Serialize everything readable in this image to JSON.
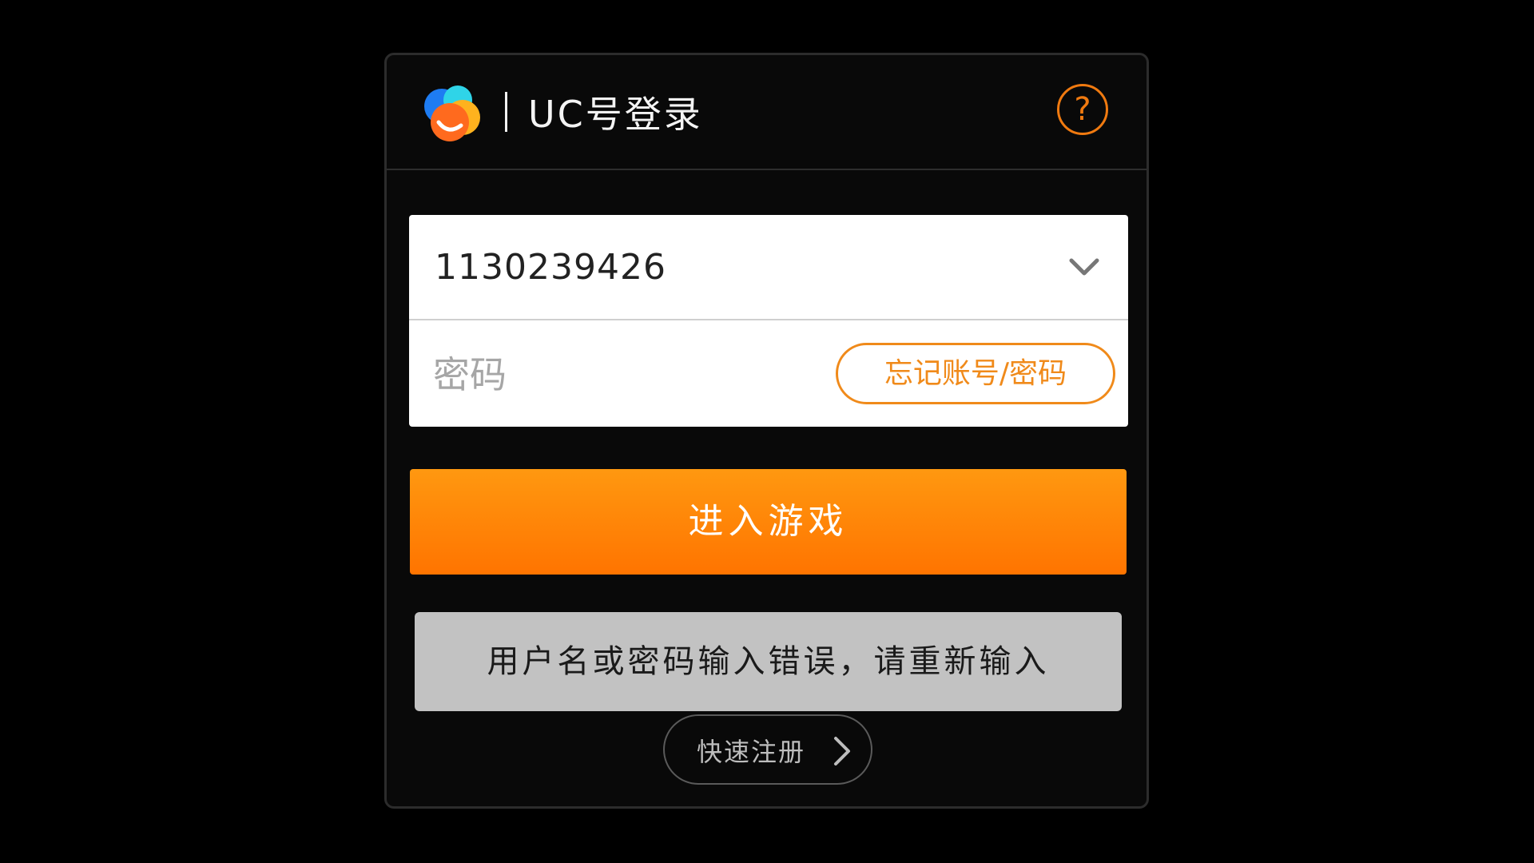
{
  "header": {
    "title": "UC号登录",
    "help_icon_text": "?"
  },
  "form": {
    "account_value": "1130239426",
    "password_placeholder": "密码",
    "forgot_label": "忘记账号/密码"
  },
  "actions": {
    "enter_label": "进入游戏",
    "register_label": "快速注册"
  },
  "toast": {
    "message": "用户名或密码输入错误，请重新输入"
  },
  "icons": {
    "logo": "uc-logo-icon",
    "help": "question-circle-icon",
    "dropdown": "chevron-down-icon",
    "register_arrow": "chevron-right-icon"
  },
  "colors": {
    "accent": "#f07a10",
    "button_top": "#ff9810",
    "button_bottom": "#ff7400",
    "toast_bg": "#c2c2c2"
  }
}
